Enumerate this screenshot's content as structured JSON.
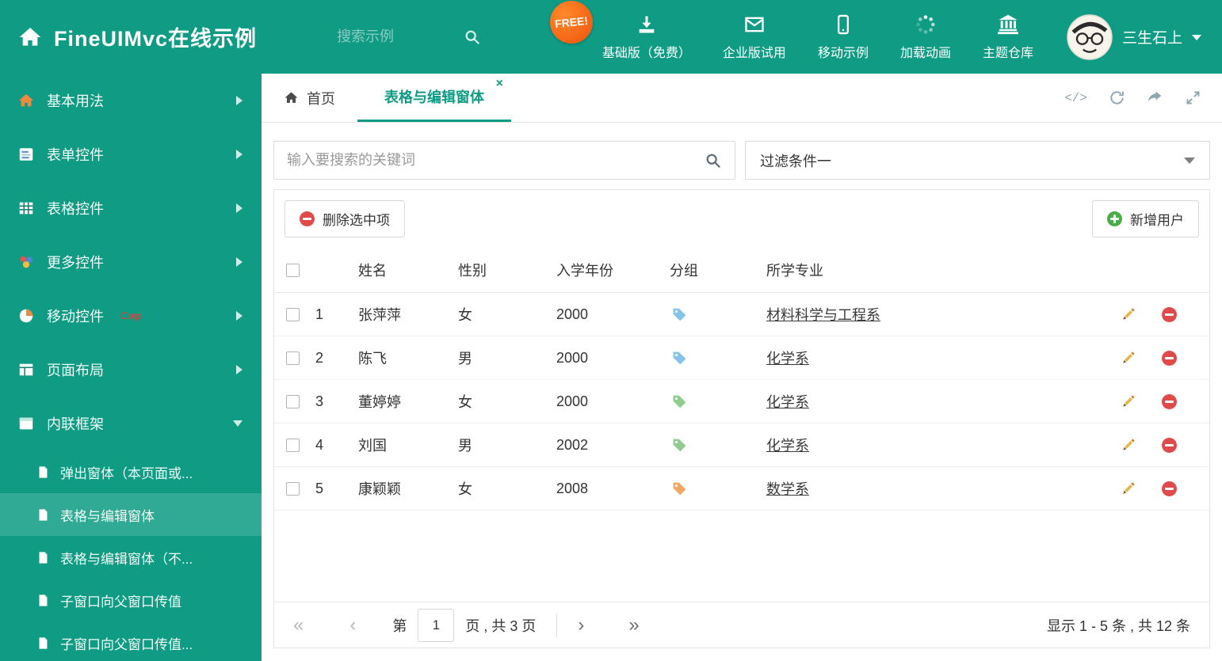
{
  "header": {
    "title": "FineUIMvc在线示例",
    "search_placeholder": "搜索示例",
    "free_badge": "FREE!",
    "nav": [
      {
        "label": "基础版（免费）"
      },
      {
        "label": "企业版试用"
      },
      {
        "label": "移动示例"
      },
      {
        "label": "加载动画"
      },
      {
        "label": "主题仓库"
      }
    ],
    "user_name": "三生石上"
  },
  "sidebar": {
    "items": [
      {
        "label": "基本用法"
      },
      {
        "label": "表单控件"
      },
      {
        "label": "表格控件"
      },
      {
        "label": "更多控件"
      },
      {
        "label": "移动控件",
        "badge": "Corp"
      },
      {
        "label": "页面布局"
      },
      {
        "label": "内联框架"
      }
    ],
    "subitems": [
      {
        "label": "弹出窗体（本页面或..."
      },
      {
        "label": "表格与编辑窗体"
      },
      {
        "label": "表格与编辑窗体（不..."
      },
      {
        "label": "子窗口向父窗口传值"
      },
      {
        "label": "子窗口向父窗口传值..."
      }
    ]
  },
  "tabs": {
    "home_label": "首页",
    "active_label": "表格与编辑窗体"
  },
  "filter": {
    "search_placeholder": "输入要搜索的关键词",
    "dropdown_value": "过滤条件一"
  },
  "toolbar": {
    "delete_label": "删除选中项",
    "add_label": "新增用户"
  },
  "table": {
    "headers": [
      "姓名",
      "性别",
      "入学年份",
      "分组",
      "所学专业"
    ],
    "rows": [
      {
        "num": "1",
        "name": "张萍萍",
        "gender": "女",
        "year": "2000",
        "tag_color": "#85C4EA",
        "major": "材料科学与工程系"
      },
      {
        "num": "2",
        "name": "陈飞",
        "gender": "男",
        "year": "2000",
        "tag_color": "#85C4EA",
        "major": "化学系"
      },
      {
        "num": "3",
        "name": "董婷婷",
        "gender": "女",
        "year": "2000",
        "tag_color": "#8FCD8F",
        "major": "化学系"
      },
      {
        "num": "4",
        "name": "刘国",
        "gender": "男",
        "year": "2002",
        "tag_color": "#8FCD8F",
        "major": "化学系"
      },
      {
        "num": "5",
        "name": "康颖颖",
        "gender": "女",
        "year": "2008",
        "tag_color": "#F0A860",
        "major": "数学系"
      }
    ]
  },
  "pagination": {
    "prefix": "第",
    "current_page": "1",
    "suffix": "页 , 共 3 页",
    "summary": "显示 1 - 5 条 , 共 12 条"
  },
  "icons": {
    "code": "</>",
    "close": "×",
    "pg_first": "«",
    "pg_prev": "‹",
    "pg_next": "›",
    "pg_last": "»"
  },
  "colors": {
    "accent": "#0F9B84",
    "delete_red": "#DF4B4B",
    "add_green": "#47AD47"
  }
}
